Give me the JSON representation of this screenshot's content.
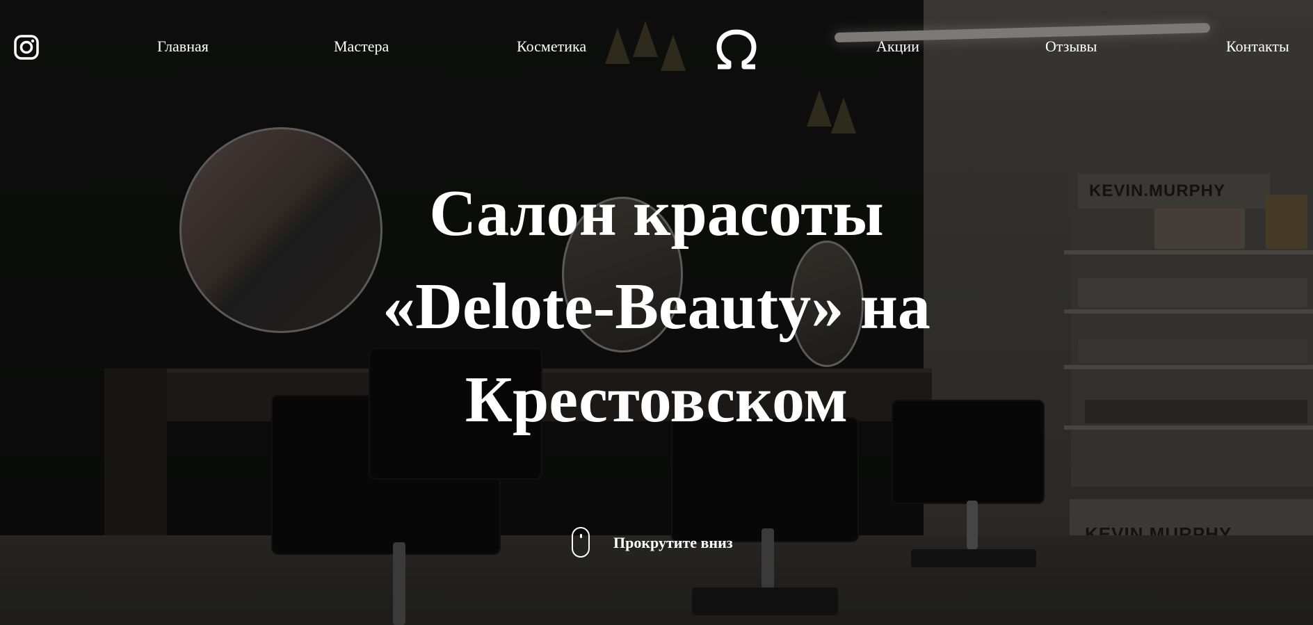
{
  "header": {
    "instagram_icon": "instagram-icon",
    "logo_icon": "omega-logo-icon",
    "nav_left": [
      {
        "label": "Главная"
      },
      {
        "label": "Мастера"
      },
      {
        "label": "Косметика"
      }
    ],
    "nav_right": [
      {
        "label": "Акции"
      },
      {
        "label": "Отзывы"
      },
      {
        "label": "Контакты"
      }
    ]
  },
  "hero": {
    "title_lines": [
      "Салон красоты",
      "«Delote-Beauty» на",
      "Крестовском"
    ]
  },
  "scroll_hint": {
    "icon": "mouse-scroll-icon",
    "label": "Прокрутите вниз"
  },
  "background": {
    "brand_signs": [
      "KEVIN.MURPHY",
      "KEVIN.MURPHY"
    ]
  },
  "colors": {
    "text": "#ffffff",
    "overlay": "rgba(0,0,0,0.35)",
    "dark_wall": "#141614",
    "light_wall": "#56534f"
  }
}
